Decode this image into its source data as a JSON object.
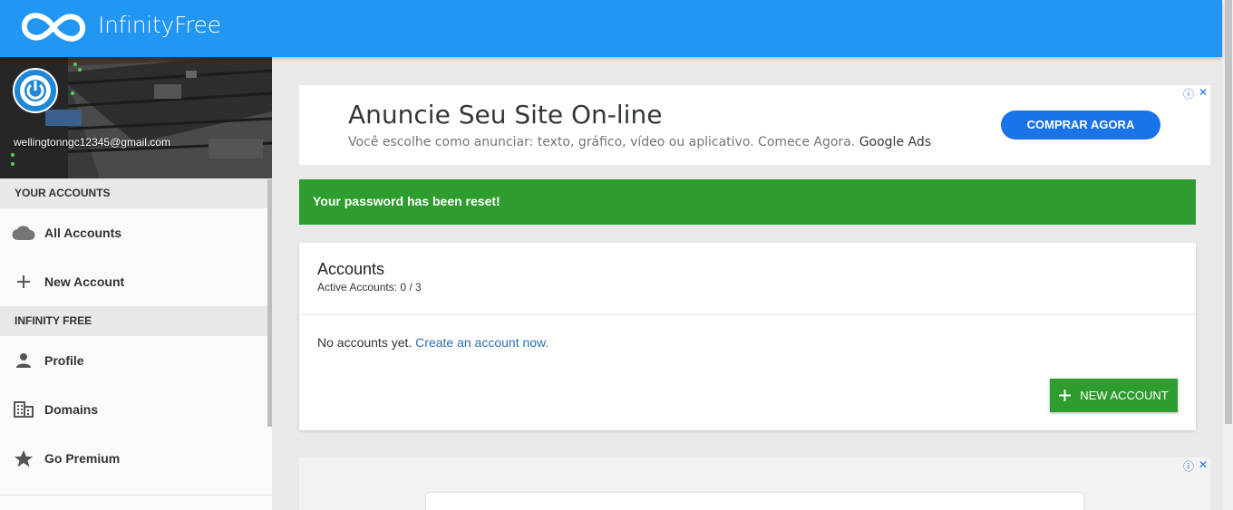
{
  "header": {
    "brand": "InfinityFree",
    "logo_icon": "infinity-icon"
  },
  "sidebar": {
    "email": "wellingtonngc12345@gmail.com",
    "sections": [
      {
        "title": "YOUR ACCOUNTS",
        "items": [
          {
            "label": "All Accounts",
            "icon": "cloud-icon"
          },
          {
            "label": "New Account",
            "icon": "plus-icon"
          }
        ]
      },
      {
        "title": "INFINITY FREE",
        "items": [
          {
            "label": "Profile",
            "icon": "person-icon"
          },
          {
            "label": "Domains",
            "icon": "building-icon"
          },
          {
            "label": "Go Premium",
            "icon": "star-icon"
          }
        ]
      }
    ]
  },
  "ad": {
    "title": "Anuncie Seu Site On-line",
    "description": "Você escolhe como anunciar: texto, gráfico, vídeo ou aplicativo. Comece Agora.",
    "source": "Google Ads",
    "button": "COMPRAR AGORA",
    "info_icon": "ⓘ",
    "close_icon": "✕"
  },
  "alert": {
    "message": "Your password has been reset!",
    "color": "#2e9c2e"
  },
  "accounts_card": {
    "title": "Accounts",
    "subtitle": "Active Accounts: 0 / 3",
    "empty_text": "No accounts yet.",
    "create_link": "Create an account now.",
    "new_button": "NEW ACCOUNT"
  },
  "colors": {
    "primary": "#2196f3",
    "success": "#2e9c2e",
    "link": "#2c6fb3"
  }
}
